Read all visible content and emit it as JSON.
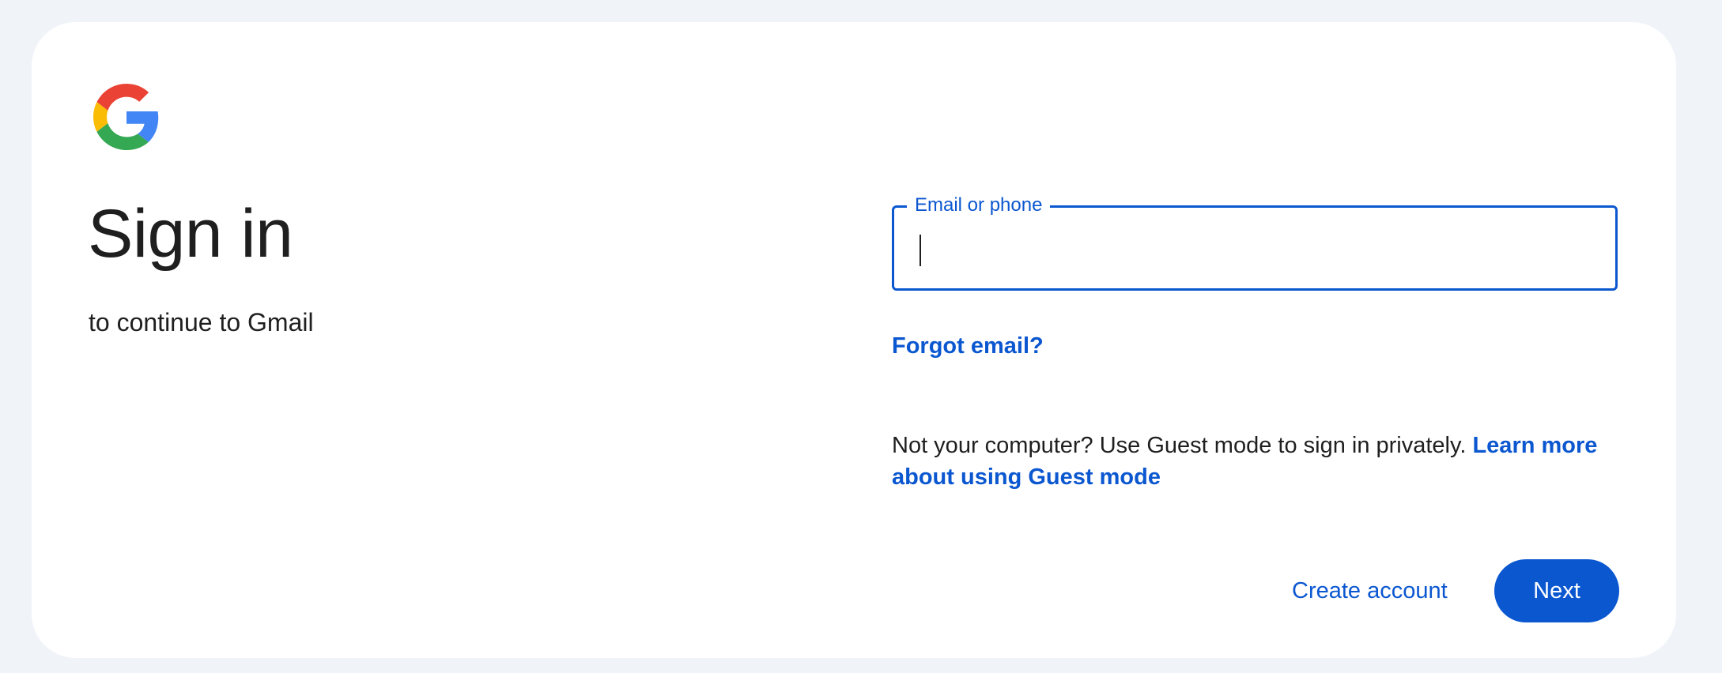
{
  "heading": {
    "title": "Sign in",
    "subtitle": "to continue to Gmail"
  },
  "logo": {
    "icon": "google-g-icon",
    "colors": {
      "red": "#ea4335",
      "yellow": "#fbbc05",
      "green": "#34a853",
      "blue": "#4285f4"
    }
  },
  "form": {
    "email_label": "Email or phone",
    "email_value": "",
    "forgot_email": "Forgot email?"
  },
  "guest": {
    "text": "Not your computer? Use Guest mode to sign in privately. ",
    "link": "Learn more about using Guest mode"
  },
  "actions": {
    "create_account": "Create account",
    "next": "Next"
  },
  "theme": {
    "accent": "#0b57d0",
    "background": "#f0f4f9",
    "card": "#ffffff",
    "text": "#1f1f1f"
  }
}
